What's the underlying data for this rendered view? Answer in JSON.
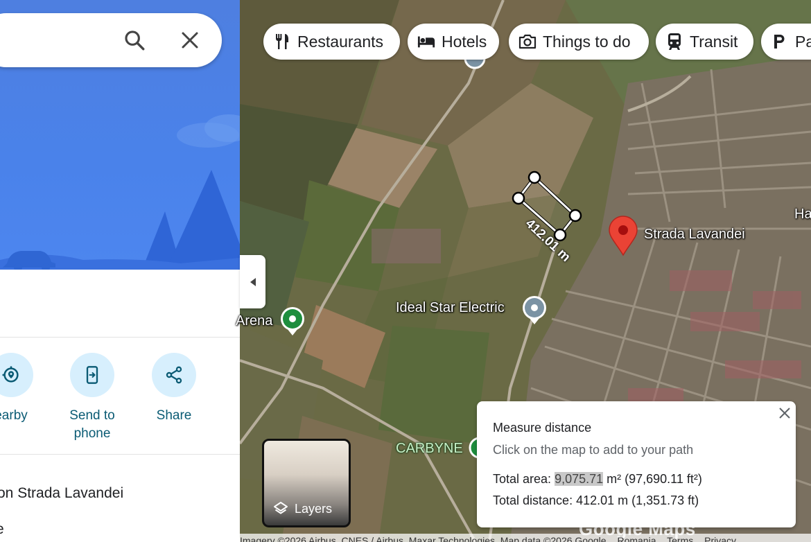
{
  "search": {
    "placeholder": ""
  },
  "actions": [
    {
      "label": "earby",
      "icon": "nearby-icon"
    },
    {
      "label": "Send to phone",
      "icon": "send-to-phone-icon"
    },
    {
      "label": "Share",
      "icon": "share-icon"
    }
  ],
  "address_line": "on Strada Lavandei",
  "address_line_2": "e",
  "chips": [
    {
      "label": "Restaurants",
      "icon": "fork-knife-icon"
    },
    {
      "label": "Hotels",
      "icon": "bed-icon"
    },
    {
      "label": "Things to do",
      "icon": "camera-icon"
    },
    {
      "label": "Transit",
      "icon": "train-icon"
    },
    {
      "label": "Pa",
      "icon": "parking-icon"
    }
  ],
  "map": {
    "places": {
      "strada": "Strada Lavandei",
      "ideal": "Ideal Star Electric",
      "arena": "Arena",
      "carbyne": "CARBYNE",
      "ha": "Ha"
    },
    "measure_label": "412.01 m",
    "layers_label": "Layers",
    "watermark": "Google Maps"
  },
  "measure": {
    "title": "Measure distance",
    "hint": "Click on the map to add to your path",
    "area_prefix": "Total area: ",
    "area_value": "9,075.71",
    "area_suffix": " m² (97,690.11 ft²)",
    "distance": "Total distance: 412.01 m (1,351.73 ft)"
  },
  "footer": {
    "imagery": "Imagery ©2026 Airbus, CNES / Airbus, Maxar Technologies, Map data ©2026 Google",
    "country": "Romania",
    "terms": "Terms",
    "privacy": "Privacy"
  },
  "colors": {
    "accent": "#0b5b74",
    "chip_bg": "#ffffff",
    "pin_red": "#ea4335",
    "place_green": "#1e8e3e"
  }
}
